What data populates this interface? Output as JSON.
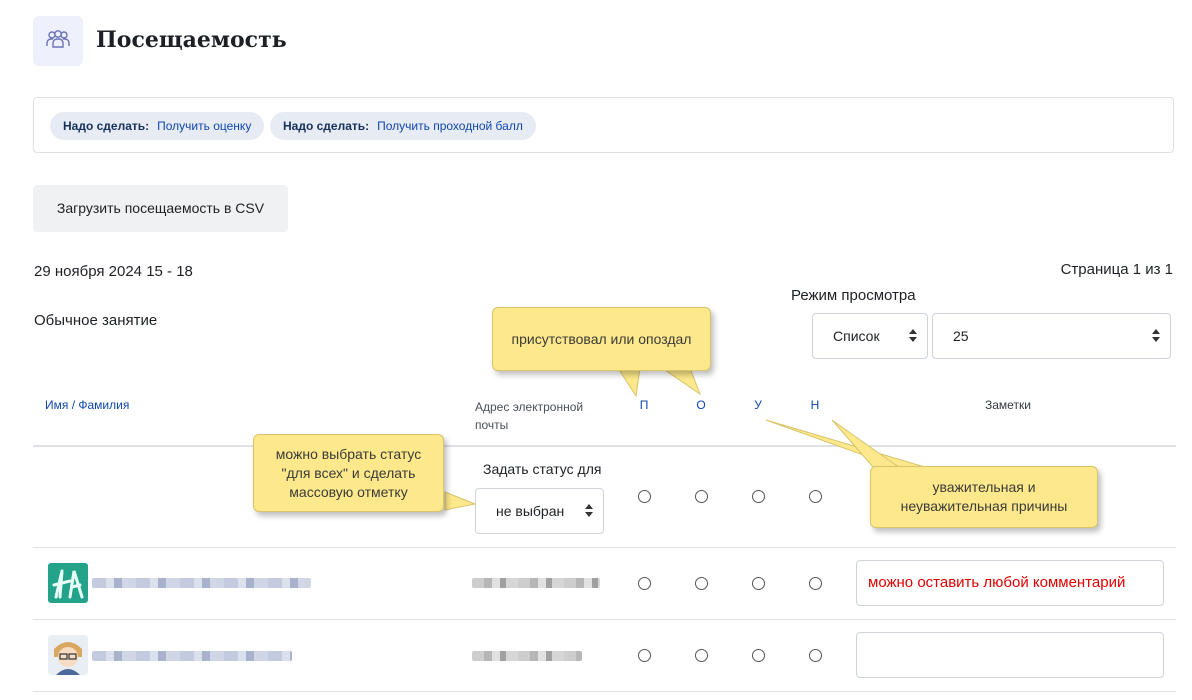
{
  "header": {
    "title": "Посещаемость",
    "icon": "users-icon"
  },
  "completion": {
    "items": [
      {
        "prefix": "Надо сделать:",
        "text": "Получить оценку"
      },
      {
        "prefix": "Надо сделать:",
        "text": "Получить проходной балл"
      }
    ]
  },
  "actions": {
    "upload_csv": "Загрузить посещаемость в CSV"
  },
  "session": {
    "date": "29 ноября 2024 15 - 18",
    "type": "Обычное занятие"
  },
  "pager": {
    "text": "Страница 1 из 1"
  },
  "view_mode": {
    "label": "Режим просмотра",
    "mode_value": "Список",
    "per_page_value": "25"
  },
  "table": {
    "headers": {
      "name": "Имя / Фамилия",
      "email": "Адрес электронной почты",
      "statuses": [
        "П",
        "О",
        "У",
        "Н"
      ],
      "notes": "Заметки"
    },
    "set_all": {
      "label": "Задать статус для",
      "select_value": "не выбран"
    },
    "rows": [
      {
        "note": "можно оставить любой комментарий"
      },
      {
        "note": ""
      }
    ]
  },
  "callouts": {
    "present_late": "присутствовал или опоздал",
    "set_all": "можно выбрать статус \"для всех\" и сделать массовую отметку",
    "excused": "уважительная и неуважительная причины"
  },
  "colors": {
    "link": "#0f47ad",
    "callout": "#fde98b",
    "note_text": "#e00000"
  }
}
